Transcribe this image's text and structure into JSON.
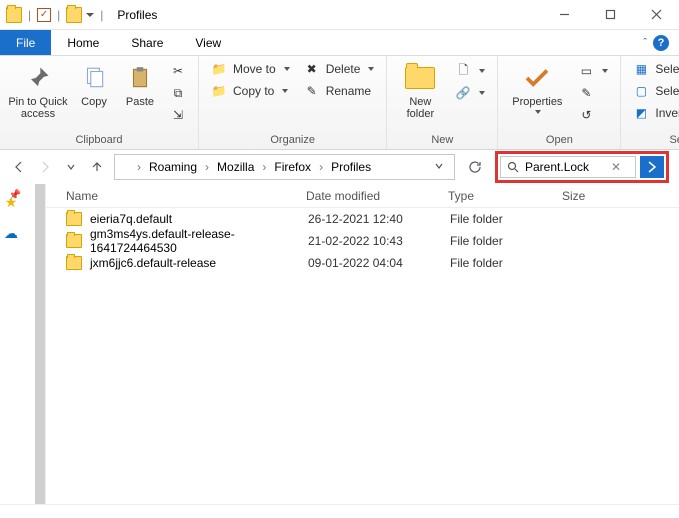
{
  "window": {
    "title": "Profiles"
  },
  "tabs": {
    "file": "File",
    "home": "Home",
    "share": "Share",
    "view": "View"
  },
  "ribbon": {
    "clipboard": {
      "label": "Clipboard",
      "pin": "Pin to Quick access",
      "copy": "Copy",
      "paste": "Paste"
    },
    "organize": {
      "label": "Organize",
      "move": "Move to",
      "copy": "Copy to",
      "del": "Delete",
      "rename": "Rename"
    },
    "new": {
      "label": "New",
      "folder": "New folder"
    },
    "open": {
      "label": "Open",
      "properties": "Properties"
    },
    "select": {
      "label": "Select",
      "all": "Select all",
      "none": "Select none",
      "invert": "Invert selection"
    }
  },
  "breadcrumb": [
    "Roaming",
    "Mozilla",
    "Firefox",
    "Profiles"
  ],
  "search": {
    "value": "Parent.Lock"
  },
  "columns": {
    "name": "Name",
    "date": "Date modified",
    "type": "Type",
    "size": "Size"
  },
  "rows": [
    {
      "name": "eieria7q.default",
      "date": "26-12-2021 12:40",
      "type": "File folder"
    },
    {
      "name": "gm3ms4ys.default-release-1641724464530",
      "date": "21-02-2022 10:43",
      "type": "File folder"
    },
    {
      "name": "jxm6jjc6.default-release",
      "date": "09-01-2022 04:04",
      "type": "File folder"
    }
  ]
}
